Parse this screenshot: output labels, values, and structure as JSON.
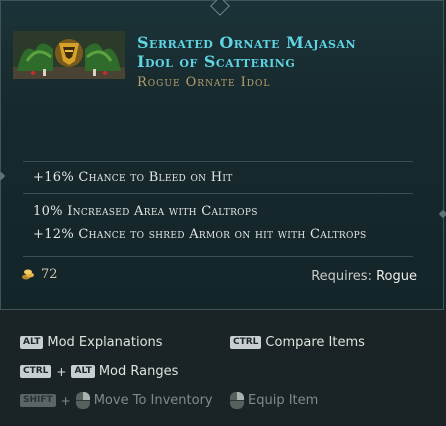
{
  "item": {
    "title_line1": "Serrated Ornate Majasan",
    "title_line2": "Idol of Scattering",
    "subtitle": "Rogue Ornate Idol",
    "image_icon": "idol-art"
  },
  "mods": {
    "implicit": "+16% Chance to Bleed on Hit",
    "affix1": "10% Increased Area with Caltrops",
    "affix2": "+12% Chance to shred Armor on hit with Caltrops"
  },
  "footer": {
    "price": "72",
    "price_icon": "gold-coin-icon",
    "requires_label": "Requires:",
    "requires_class": "Rogue"
  },
  "hints": {
    "mod_explanations": {
      "key": "ALT",
      "label": "Mod Explanations"
    },
    "compare_items": {
      "key": "CTRL",
      "label": "Compare Items"
    },
    "mod_ranges": {
      "key1": "CTRL",
      "plus": "+",
      "key2": "ALT",
      "label": "Mod Ranges"
    },
    "move_inventory": {
      "key": "SHIFT",
      "plus": "+",
      "label": "Move To Inventory"
    },
    "equip_item": {
      "label": "Equip Item"
    }
  },
  "colors": {
    "title": "#5fd5e3",
    "subtitle": "#b89e6e",
    "panel": "#17292d"
  }
}
